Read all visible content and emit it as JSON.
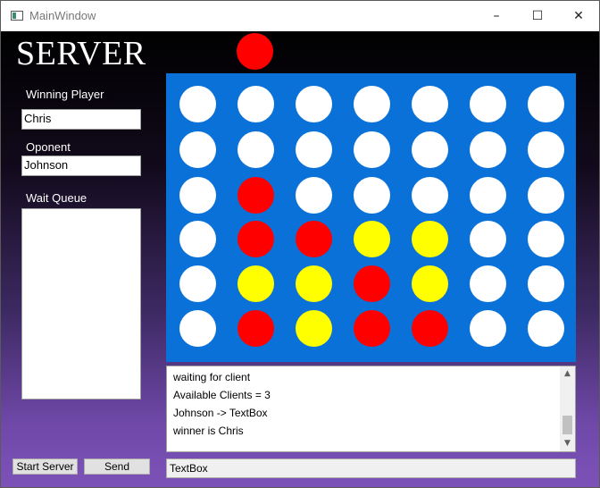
{
  "window": {
    "title": "MainWindow",
    "controls": {
      "minimize": "–",
      "maximize": "☐",
      "close": "✕"
    }
  },
  "header": {
    "title": "SERVER",
    "current_turn_color": "#ff0000"
  },
  "left_panel": {
    "winning_player_label": "Winning Player",
    "winning_player_value": "Chris",
    "opponent_label": "Oponent",
    "opponent_value": "Johnson",
    "wait_queue_label": "Wait Queue",
    "wait_queue_items": []
  },
  "board": {
    "background_color": "#0a71d9",
    "colors": {
      "W": "#ffffff",
      "R": "#ff0000",
      "Y": "#ffff00"
    },
    "rows": [
      [
        "W",
        "W",
        "W",
        "W",
        "W",
        "W",
        "W"
      ],
      [
        "W",
        "W",
        "W",
        "W",
        "W",
        "W",
        "W"
      ],
      [
        "W",
        "R",
        "W",
        "W",
        "W",
        "W",
        "W"
      ],
      [
        "W",
        "R",
        "R",
        "Y",
        "Y",
        "W",
        "W"
      ],
      [
        "W",
        "Y",
        "Y",
        "R",
        "Y",
        "W",
        "W"
      ],
      [
        "W",
        "R",
        "Y",
        "R",
        "R",
        "W",
        "W"
      ]
    ]
  },
  "log": {
    "lines": [
      "waiting for client",
      "Available Clients = 3",
      "Johnson -> TextBox",
      "winner is Chris"
    ],
    "scroll_up_icon": "▲",
    "scroll_down_icon": "▼"
  },
  "buttons": {
    "start_server_label": "Start Server",
    "send_label": "Send"
  },
  "send_input": {
    "value": "TextBox"
  }
}
